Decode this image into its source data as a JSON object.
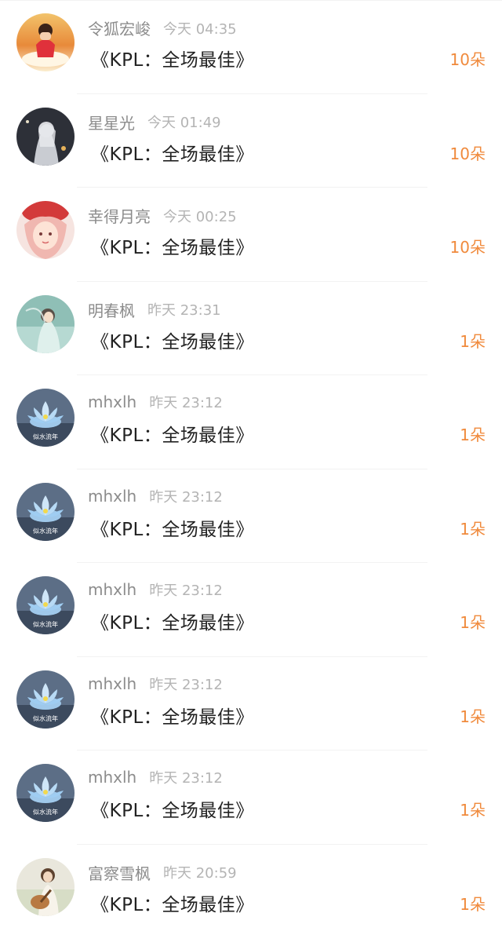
{
  "rows": [
    {
      "name": "令狐宏峻",
      "time": "今天 04:35",
      "title": "《KPL：全场最佳》",
      "count": "10朵",
      "avatar": "avatar-red-girl-icon"
    },
    {
      "name": "星星光",
      "time": "今天 01:49",
      "title": "《KPL：全场最佳》",
      "count": "10朵",
      "avatar": "avatar-anime-night-icon"
    },
    {
      "name": "幸得月亮",
      "time": "今天 00:25",
      "title": "《KPL：全场最佳》",
      "count": "10朵",
      "avatar": "avatar-pink-girl-icon"
    },
    {
      "name": "明春枫",
      "time": "昨天 23:31",
      "title": "《KPL：全场最佳》",
      "count": "1朵",
      "avatar": "avatar-teal-anime-icon"
    },
    {
      "name": "mhxlh",
      "time": "昨天 23:12",
      "title": "《KPL：全场最佳》",
      "count": "1朵",
      "avatar": "avatar-lotus-icon"
    },
    {
      "name": "mhxlh",
      "time": "昨天 23:12",
      "title": "《KPL：全场最佳》",
      "count": "1朵",
      "avatar": "avatar-lotus-icon"
    },
    {
      "name": "mhxlh",
      "time": "昨天 23:12",
      "title": "《KPL：全场最佳》",
      "count": "1朵",
      "avatar": "avatar-lotus-icon"
    },
    {
      "name": "mhxlh",
      "time": "昨天 23:12",
      "title": "《KPL：全场最佳》",
      "count": "1朵",
      "avatar": "avatar-lotus-icon"
    },
    {
      "name": "mhxlh",
      "time": "昨天 23:12",
      "title": "《KPL：全场最佳》",
      "count": "1朵",
      "avatar": "avatar-lotus-icon"
    },
    {
      "name": "富察雪枫",
      "time": "昨天 20:59",
      "title": "《KPL：全场最佳》",
      "count": "1朵",
      "avatar": "avatar-guitar-girl-icon"
    }
  ],
  "lotus_watermark": "似水流年",
  "colors": {
    "name": "#8c8c8c",
    "time": "#b4b4b4",
    "title": "#222222",
    "count": "#f08a3c"
  }
}
